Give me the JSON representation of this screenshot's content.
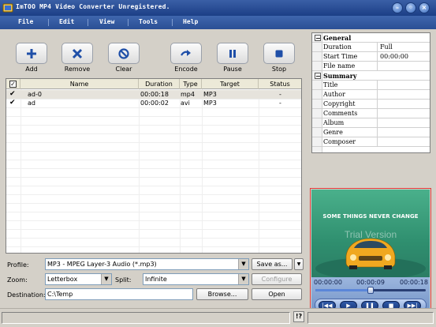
{
  "window": {
    "title": "ImTOO MP4 Video Converter Unregistered.",
    "controls": [
      "minimize-icon",
      "restore-icon",
      "close-icon"
    ]
  },
  "menu": {
    "items": [
      "File",
      "Edit",
      "View",
      "Tools",
      "Help"
    ]
  },
  "toolbar": {
    "buttons": [
      {
        "label": "Add",
        "icon": "plus-icon"
      },
      {
        "label": "Remove",
        "icon": "x-icon"
      },
      {
        "label": "Clear",
        "icon": "clear-icon"
      },
      {
        "label": "Encode",
        "icon": "encode-arrow-icon"
      },
      {
        "label": "Pause",
        "icon": "pause-icon"
      },
      {
        "label": "Stop",
        "icon": "stop-icon"
      }
    ]
  },
  "filelist": {
    "columns": [
      "Name",
      "Duration",
      "Type",
      "Target",
      "Status"
    ],
    "rows": [
      {
        "checked": true,
        "name": "ad-0",
        "duration": "00:00:18",
        "type": "mp4",
        "target": "MP3",
        "status": "-"
      },
      {
        "checked": true,
        "name": "ad",
        "duration": "00:00:02",
        "type": "avi",
        "target": "MP3",
        "status": "-"
      }
    ]
  },
  "form": {
    "profile_label": "Profile:",
    "profile_value": "MP3 - MPEG Layer-3 Audio  (*.mp3)",
    "save_as_label": "Save as...",
    "zoom_label": "Zoom:",
    "zoom_value": "Letterbox",
    "split_label": "Split:",
    "split_value": "Infinite",
    "configure_label": "Configure",
    "destination_label": "Destination:",
    "destination_value": "C:\\Temp",
    "browse_label": "Browse...",
    "open_label": "Open"
  },
  "properties": {
    "groups": [
      {
        "name": "General",
        "rows": [
          {
            "name": "Duration",
            "value": "Full"
          },
          {
            "name": "Start Time",
            "value": "00:00:00"
          },
          {
            "name": "File name",
            "value": ""
          }
        ]
      },
      {
        "name": "Summary",
        "rows": [
          {
            "name": "Title",
            "value": ""
          },
          {
            "name": "Author",
            "value": ""
          },
          {
            "name": "Copyright",
            "value": ""
          },
          {
            "name": "Comments",
            "value": ""
          },
          {
            "name": "Album",
            "value": ""
          },
          {
            "name": "Genre",
            "value": ""
          },
          {
            "name": "Composer",
            "value": ""
          }
        ]
      }
    ]
  },
  "preview": {
    "caption": "SOME THINGS NEVER CHANGE",
    "watermark": "Trial Version",
    "time_start": "00:00:00",
    "time_current": "00:00:09",
    "time_end": "00:00:18",
    "progress": 0.5,
    "controls": [
      "previous-frame-icon",
      "play-icon",
      "pause-icon",
      "stop-icon",
      "next-frame-icon"
    ]
  },
  "statusbar": {
    "help_label": "!?"
  },
  "colors": {
    "title_bar": "#2a4f95",
    "preview_border": "#e23b3b",
    "video_bg": "#3aa07c",
    "car": "#f0a820"
  }
}
